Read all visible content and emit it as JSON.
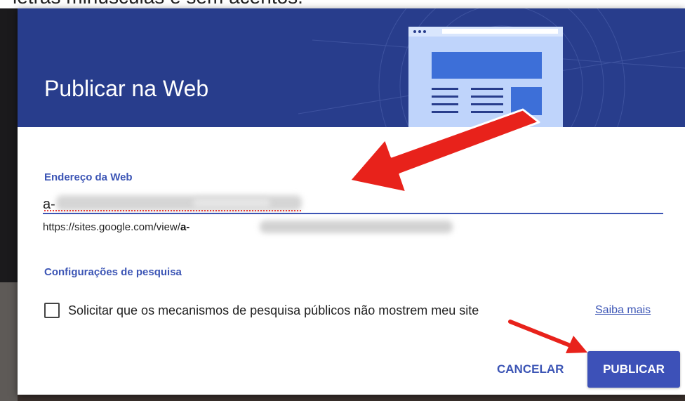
{
  "background": {
    "caption": "letras minúsculas e sem acentos."
  },
  "dialog": {
    "title": "Publicar na Web",
    "web_address": {
      "label": "Endereço da Web",
      "value": "a-",
      "url_prefix": "https://sites.google.com/view/",
      "url_visible_part": "a-"
    },
    "search_settings": {
      "label": "Configurações de pesquisa",
      "checkbox_label": "Solicitar que os mecanismos de pesquisa públicos não mostrem meu site",
      "checkbox_checked": false,
      "learn_more": "Saiba mais"
    },
    "buttons": {
      "cancel": "CANCELAR",
      "publish": "PUBLICAR"
    }
  },
  "icons": {
    "header_illustration": "webpage-illustration-icon",
    "annotation_arrows": "red-arrow-icon"
  },
  "colors": {
    "header_bg": "#283d8c",
    "accent": "#3c55b5",
    "publish_button": "#3d51b8",
    "annotation_arrow": "#e8221b"
  }
}
